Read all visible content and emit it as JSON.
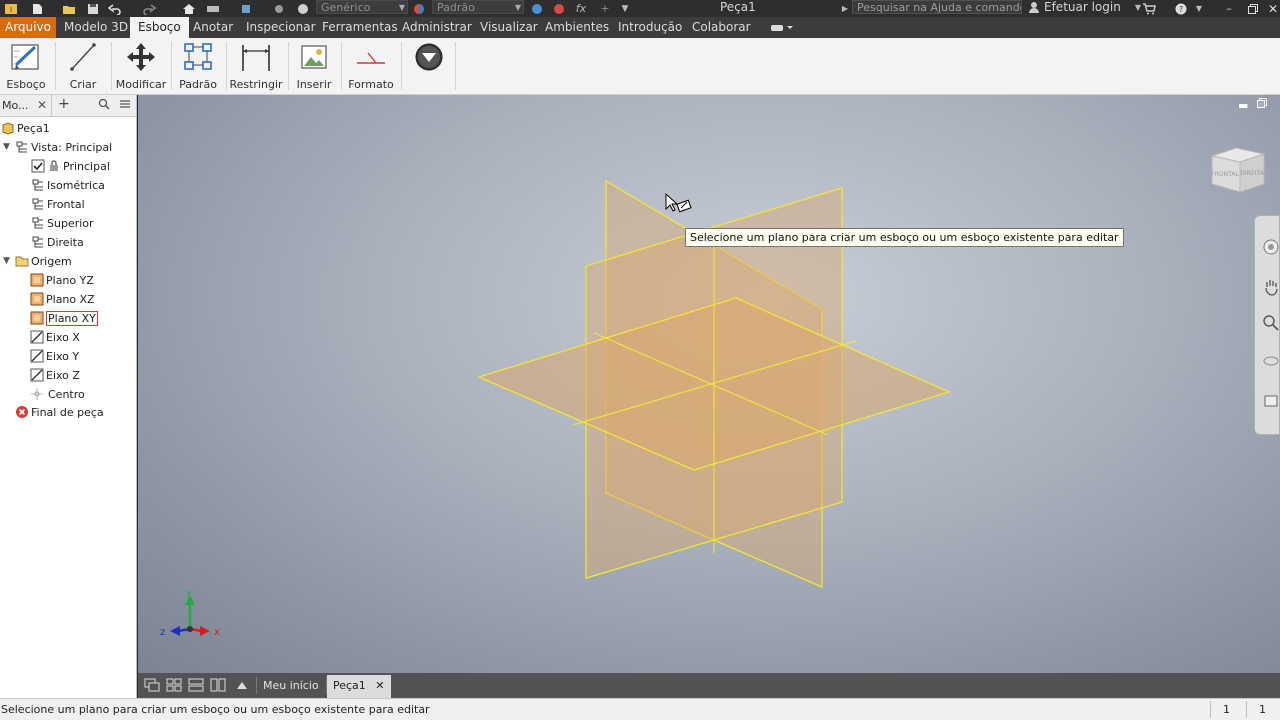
{
  "titlebar": {
    "doc_title": "Peça1",
    "material_combo": "Genérico",
    "appearance_combo": "Padrão",
    "search_placeholder": "Pesquisar na Ajuda e comandos...",
    "login_label": "Efetuar login"
  },
  "menubar": {
    "tabs": [
      "Arquivo",
      "Modelo 3D",
      "Esboço",
      "Anotar",
      "Inspecionar",
      "Ferramentas",
      "Administrar",
      "Visualizar",
      "Ambientes",
      "Introdução",
      "Colaborar"
    ],
    "active_tab": "Esboço"
  },
  "ribbon": {
    "buttons": [
      "Esboço",
      "Criar",
      "Modificar",
      "Padrão",
      "Restringir",
      "Inserir",
      "Formato"
    ]
  },
  "browser": {
    "tab_label": "Mo...",
    "tree": {
      "root": "Peça1",
      "view": "Vista: Principal",
      "views": [
        "Principal",
        "Isométrica",
        "Frontal",
        "Superior",
        "Direita"
      ],
      "origin": "Origem",
      "origin_items": [
        "Plano YZ",
        "Plano XZ",
        "Plano XY",
        "Eixo X",
        "Eixo Y",
        "Eixo Z",
        "Centro"
      ],
      "end": "Final de peça"
    }
  },
  "viewport": {
    "tooltip": "Selecione um plano para criar um esboço ou um esboço existente para editar",
    "viewcube_faces": [
      "FRONTAL",
      "DIREITA"
    ],
    "axis_labels": {
      "x": "x",
      "y": "y",
      "z": "z"
    },
    "colors": {
      "plane_fill": "#d9a870",
      "plane_edge": "#f0e23a",
      "accent": "#d96b0f"
    }
  },
  "doctabs": {
    "home": "Meu início",
    "doc": "Peça1"
  },
  "statusbar": {
    "text": "Selecione um plano para criar um esboço ou um esboço existente para editar",
    "count1": "1",
    "count2": "1"
  }
}
